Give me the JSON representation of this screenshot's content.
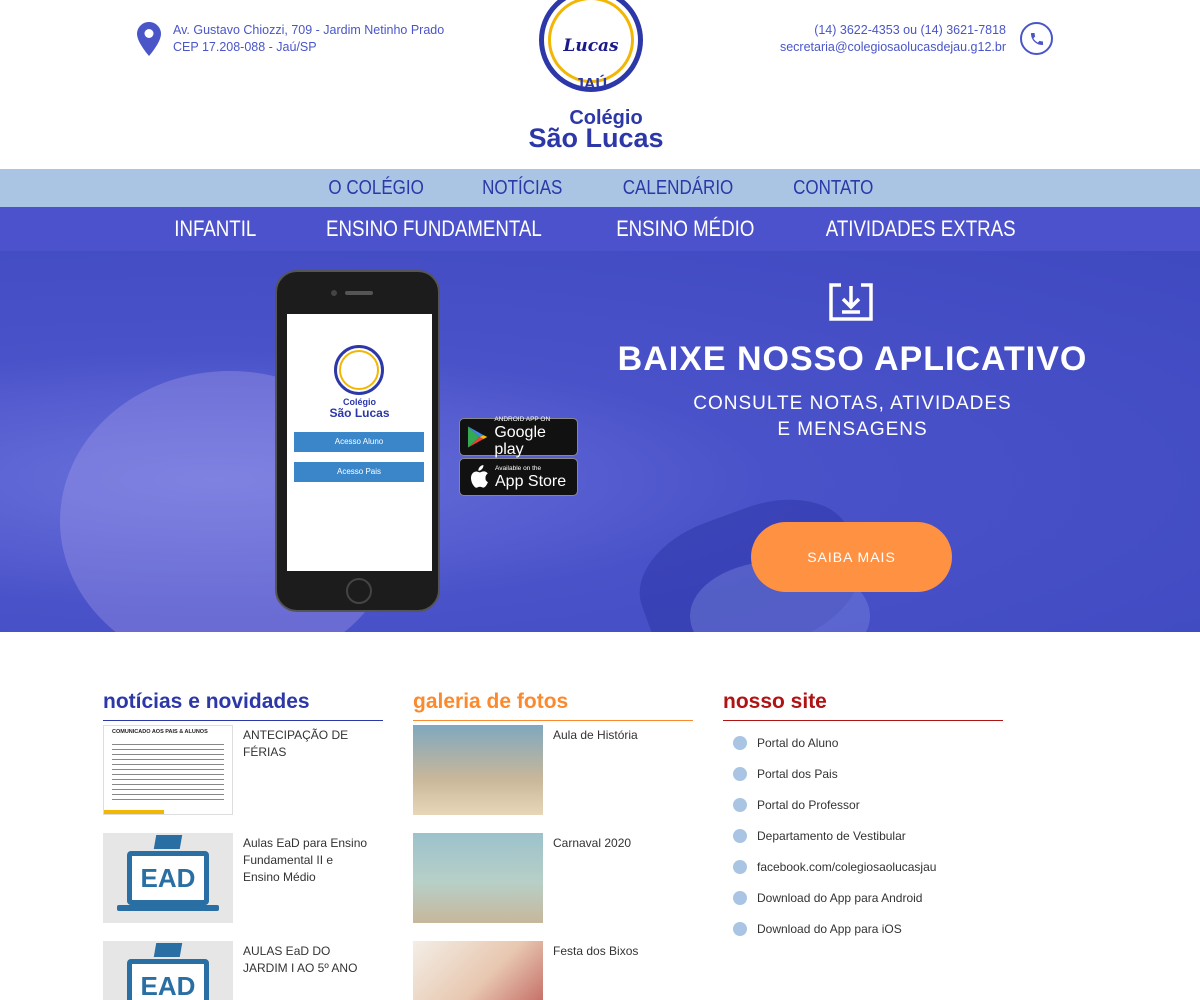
{
  "header": {
    "address_line1": "Av. Gustavo Chiozzi, 709 - Jardim Netinho Prado",
    "address_line2": "CEP 17.208-088 - Jaú/SP",
    "phones": "(14) 3622-4353 ou (14) 3621-7818",
    "email": "secretaria@colegiosaolucasdejau.g12.br",
    "logo": {
      "lucas": "Lucas",
      "city": "JAÚ",
      "line1": "Colégio",
      "line2": "São Lucas"
    }
  },
  "nav_primary": [
    "O COLÉGIO",
    "NOTÍCIAS",
    "CALENDÁRIO",
    "CONTATO"
  ],
  "nav_secondary": [
    "INFANTIL",
    "ENSINO FUNDAMENTAL",
    "ENSINO MÉDIO",
    "ATIVIDADES EXTRAS"
  ],
  "banner": {
    "title": "BAIXE NOSSO APLICATIVO",
    "subtitle_line1": "CONSULTE NOTAS, ATIVIDADES",
    "subtitle_line2": "E MENSAGENS",
    "cta": "SAIBA MAIS",
    "phone_app": {
      "colegio": "Colégio",
      "sao_lucas": "São Lucas",
      "btn_aluno": "Acesso Aluno",
      "btn_pais": "Acesso Pais"
    },
    "google_play": {
      "small": "ANDROID APP ON",
      "big": "Google play"
    },
    "app_store": {
      "small": "Available on the",
      "big": "App Store"
    }
  },
  "news": {
    "heading": "notícias e novidades",
    "items": [
      {
        "title": "ANTECIPAÇÃO DE FÉRIAS",
        "thumb_header": "COMUNICADO AOS PAIS & ALUNOS"
      },
      {
        "title": "Aulas EaD para Ensino Fundamental II e Ensino Médio",
        "thumb_label": "EAD"
      },
      {
        "title": "AULAS EaD DO JARDIM I AO 5º ANO",
        "thumb_label": "EAD"
      }
    ]
  },
  "gallery": {
    "heading": "galeria de fotos",
    "items": [
      {
        "title": "Aula de História"
      },
      {
        "title": "Carnaval 2020"
      },
      {
        "title": "Festa dos Bixos"
      }
    ]
  },
  "site": {
    "heading": "nosso site",
    "links": [
      "Portal do Aluno",
      "Portal dos Pais",
      "Portal do Professor",
      "Departamento de Vestibular",
      "facebook.com/colegiosaolucasjau",
      "Download do App para Android",
      "Download do App para iOS"
    ]
  },
  "colors": {
    "brand_blue": "#2c37a8",
    "nav_light": "#a9c5e3",
    "nav_dark": "#4c52cb",
    "cta_orange": "#fe9142",
    "gallery_orange": "#fb8a2e",
    "site_red": "#b01313"
  }
}
